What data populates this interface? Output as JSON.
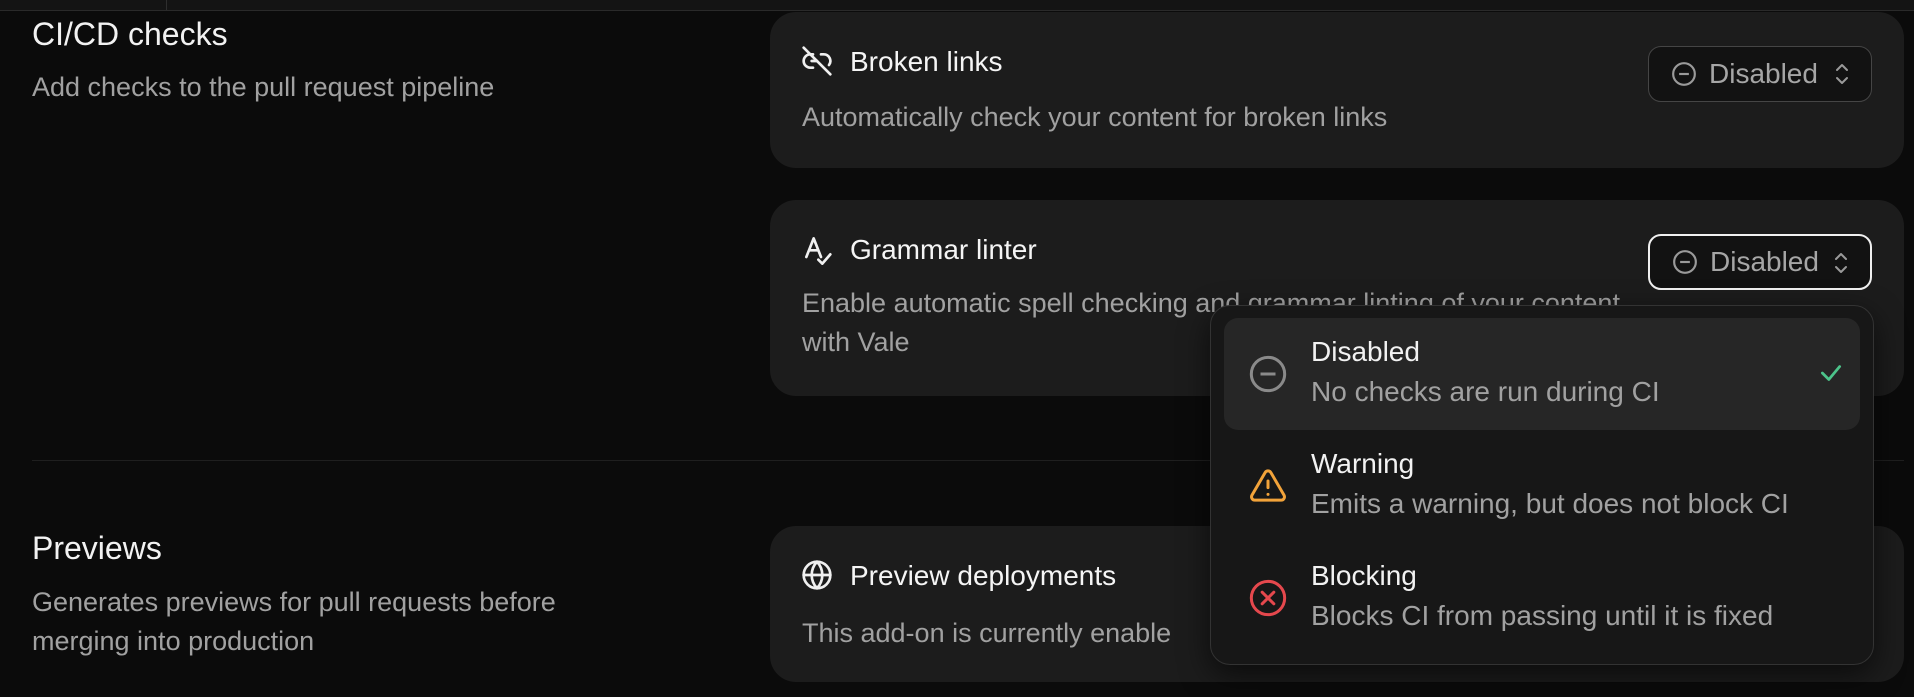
{
  "cicd": {
    "title": "CI/CD checks",
    "description": "Add checks to the pull request pipeline",
    "cards": {
      "broken_links": {
        "icon": "unlink-icon",
        "title": "Broken links",
        "description": "Automatically check your content for broken links",
        "select_value": "Disabled"
      },
      "grammar": {
        "icon": "spellcheck-icon",
        "title": "Grammar linter",
        "description": "Enable automatic spell checking and grammar linting of your content with Vale",
        "select_value": "Disabled"
      }
    }
  },
  "previews": {
    "title": "Previews",
    "description": "Generates previews for pull requests before merging into production",
    "card": {
      "icon": "globe-icon",
      "title": "Preview deployments",
      "description": "This add-on is currently enable"
    }
  },
  "dropdown": {
    "options": [
      {
        "icon": "minus-circle-icon",
        "label": "Disabled",
        "description": "No checks are run during CI",
        "selected": true,
        "color": "#8a8a8a"
      },
      {
        "icon": "warning-triangle-icon",
        "label": "Warning",
        "description": "Emits a warning, but does not block CI",
        "selected": false,
        "color": "#f2a33a"
      },
      {
        "icon": "x-circle-icon",
        "label": "Blocking",
        "description": "Blocks CI from passing until it is fixed",
        "selected": false,
        "color": "#e5484d"
      }
    ],
    "check_color": "#4cc38a"
  }
}
